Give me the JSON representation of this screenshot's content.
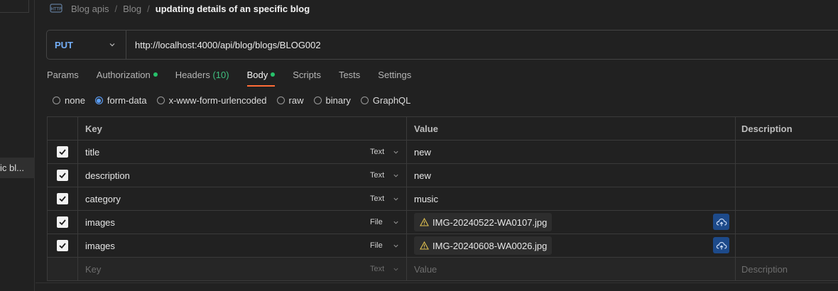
{
  "sidebar": {
    "selected_item_label": "ic bl..."
  },
  "breadcrumb": {
    "items": [
      "Blog apis",
      "Blog"
    ],
    "current": "updating details of an specific blog"
  },
  "request": {
    "method": "PUT",
    "url": "http://localhost:4000/api/blog/blogs/BLOG002"
  },
  "tabs": [
    {
      "label": "Params"
    },
    {
      "label": "Authorization"
    },
    {
      "label": "Headers",
      "count": "(10)"
    },
    {
      "label": "Body"
    },
    {
      "label": "Scripts"
    },
    {
      "label": "Tests"
    },
    {
      "label": "Settings"
    }
  ],
  "body_types": {
    "options": [
      "none",
      "form-data",
      "x-www-form-urlencoded",
      "raw",
      "binary",
      "GraphQL"
    ],
    "selected": "form-data"
  },
  "table": {
    "headers": {
      "key": "Key",
      "value": "Value",
      "description": "Description"
    },
    "rows": [
      {
        "key": "title",
        "type": "Text",
        "value": "new",
        "checked": true
      },
      {
        "key": "description",
        "type": "Text",
        "value": "new",
        "checked": true
      },
      {
        "key": "category",
        "type": "Text",
        "value": "music",
        "checked": true
      },
      {
        "key": "images",
        "type": "File",
        "value": "IMG-20240522-WA0107.jpg",
        "checked": true
      },
      {
        "key": "images",
        "type": "File",
        "value": "IMG-20240608-WA0026.jpg",
        "checked": true
      }
    ],
    "placeholder": {
      "key": "Key",
      "type": "Text",
      "value": "Value",
      "description": "Description"
    }
  },
  "colors": {
    "accent": "#ff6c37",
    "method": "#74aef6",
    "dot": "#27c26b",
    "upload": "#1d4a8a"
  }
}
